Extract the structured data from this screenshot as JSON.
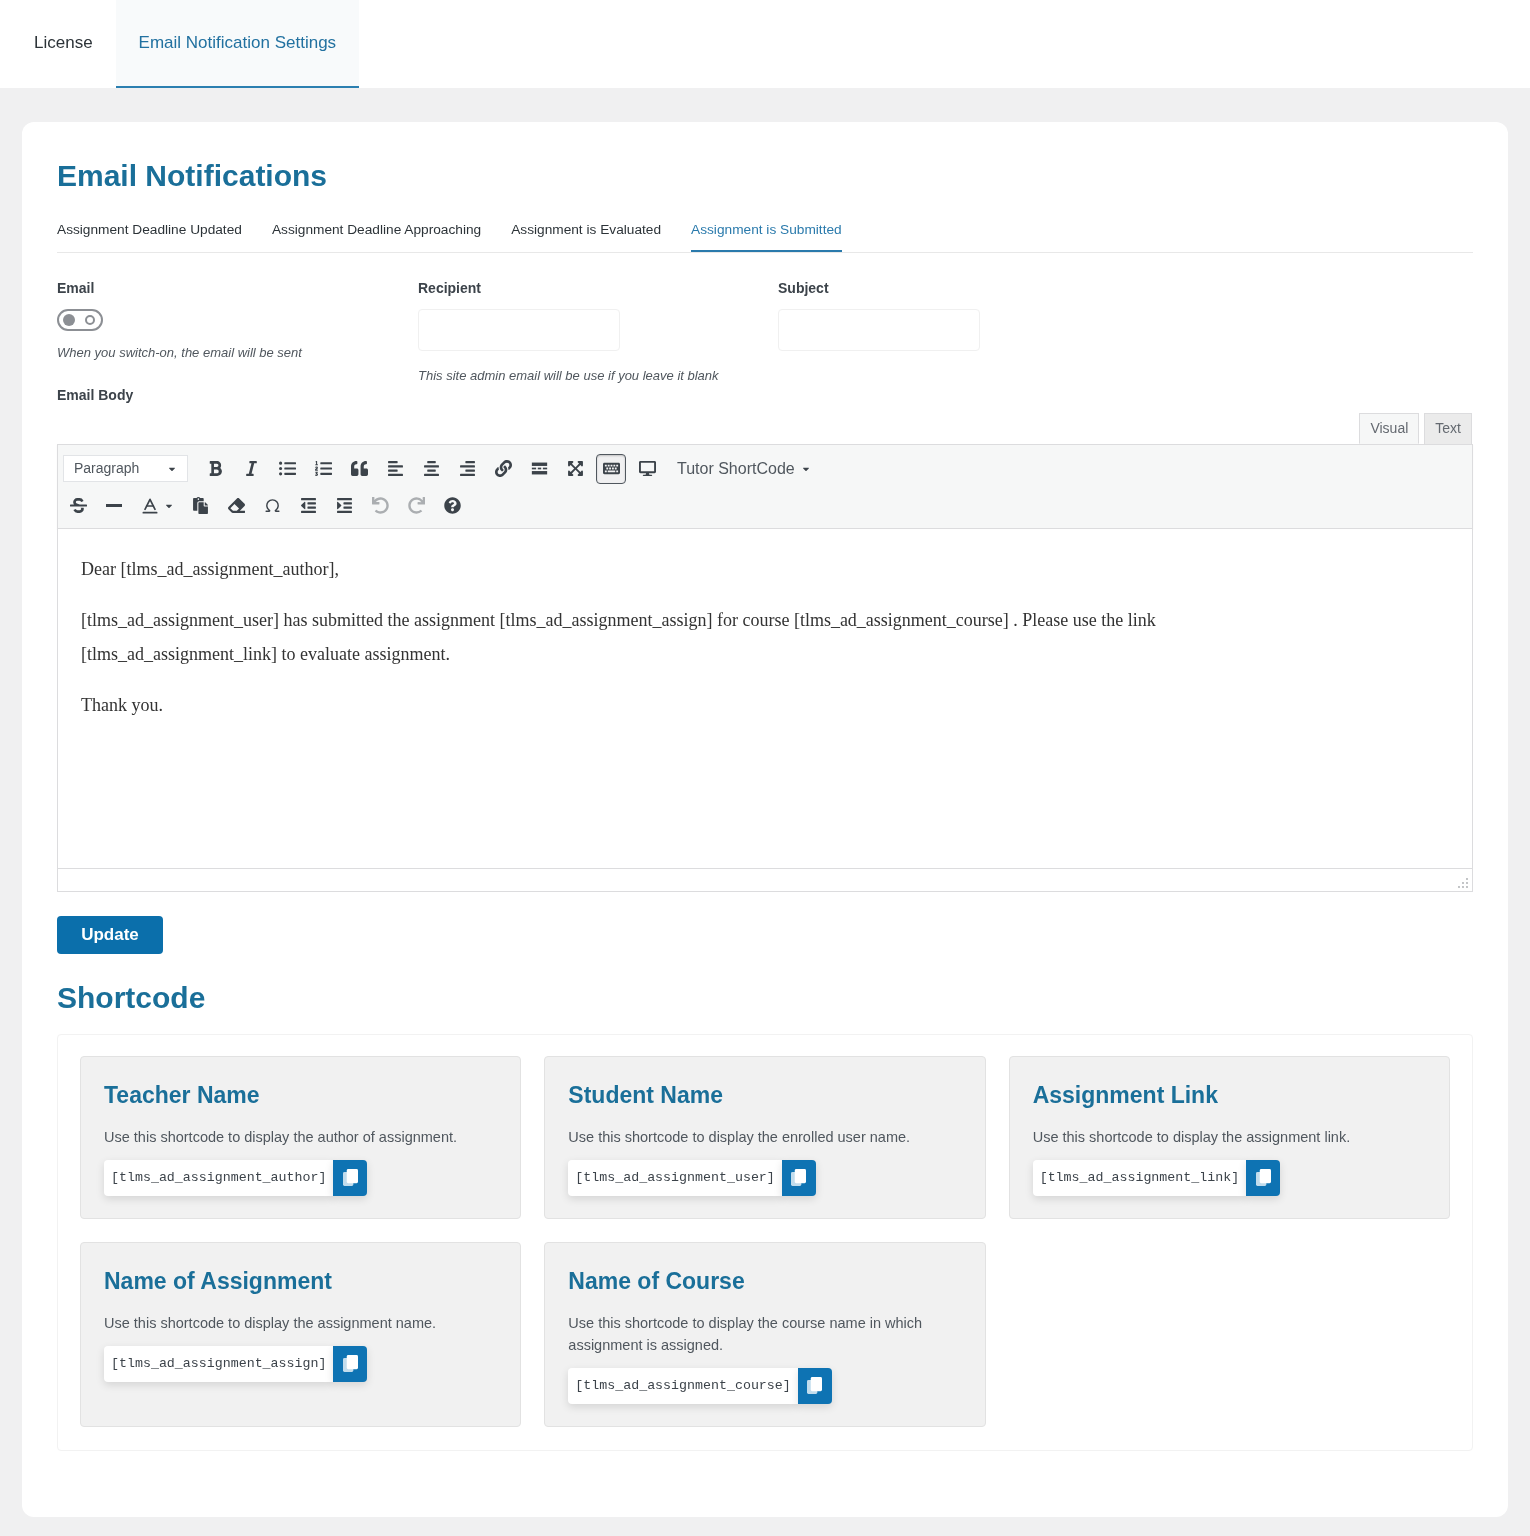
{
  "top_tabs": [
    {
      "label": "License",
      "selected": false
    },
    {
      "label": "Email Notification Settings",
      "selected": true
    }
  ],
  "title": "Email Notifications",
  "notification_tabs": [
    {
      "label": "Assignment Deadline Updated",
      "selected": false
    },
    {
      "label": "Assignment Deadline Approaching",
      "selected": false
    },
    {
      "label": "Assignment is Evaluated",
      "selected": false
    },
    {
      "label": "Assignment is Submitted",
      "selected": true
    }
  ],
  "email": {
    "label": "Email",
    "on": false,
    "hint": "When you switch-on, the email will be sent"
  },
  "recipient": {
    "label": "Recipient",
    "hint": "This site admin email will be use if you leave it blank"
  },
  "subject": {
    "label": "Subject"
  },
  "email_body": {
    "label": "Email Body",
    "editor_tabs": [
      {
        "label": "Visual",
        "selected": true
      },
      {
        "label": "Text",
        "selected": false
      }
    ],
    "toolbar": [
      [
        {
          "kind": "format-select",
          "label": "Paragraph",
          "active": false,
          "disabled": false
        },
        {
          "kind": "bold",
          "active": false,
          "disabled": false
        },
        {
          "kind": "italic",
          "active": false,
          "disabled": false
        },
        {
          "kind": "bullet-list",
          "active": false,
          "disabled": false
        },
        {
          "kind": "numbered-list",
          "active": false,
          "disabled": false
        },
        {
          "kind": "blockquote",
          "active": false,
          "disabled": false
        },
        {
          "kind": "align-left",
          "active": false,
          "disabled": false
        },
        {
          "kind": "align-center",
          "active": false,
          "disabled": false
        },
        {
          "kind": "align-right",
          "active": false,
          "disabled": false
        },
        {
          "kind": "link",
          "active": false,
          "disabled": false
        },
        {
          "kind": "read-more",
          "active": false,
          "disabled": false
        },
        {
          "kind": "fullscreen",
          "active": false,
          "disabled": false
        },
        {
          "kind": "toolbar-toggle",
          "active": true,
          "disabled": false
        },
        {
          "kind": "preview",
          "active": false,
          "disabled": false
        },
        {
          "kind": "menu",
          "label": "Tutor ShortCode",
          "active": false,
          "disabled": false
        }
      ],
      [
        {
          "kind": "strikethrough",
          "active": false,
          "disabled": false
        },
        {
          "kind": "horizontal-line",
          "active": false,
          "disabled": false
        },
        {
          "kind": "text-color",
          "active": false,
          "disabled": false
        },
        {
          "kind": "paste-text",
          "active": false,
          "disabled": false
        },
        {
          "kind": "clear-formatting",
          "active": false,
          "disabled": false
        },
        {
          "kind": "special-character",
          "active": false,
          "disabled": false
        },
        {
          "kind": "outdent",
          "active": false,
          "disabled": false
        },
        {
          "kind": "indent",
          "active": false,
          "disabled": false
        },
        {
          "kind": "undo",
          "active": false,
          "disabled": true
        },
        {
          "kind": "redo",
          "active": false,
          "disabled": true
        },
        {
          "kind": "help",
          "active": false,
          "disabled": false
        }
      ]
    ],
    "paragraphs": [
      "Dear [tlms_ad_assignment_author],",
      "[tlms_ad_assignment_user] has submitted the assignment [tlms_ad_assignment_assign] for course [tlms_ad_assignment_course] . Please use the link [tlms_ad_assignment_link] to evaluate assignment.",
      "Thank you."
    ]
  },
  "update_button": "Update",
  "shortcode": {
    "title": "Shortcode",
    "cards": [
      {
        "title": "Teacher Name",
        "description": "Use this shortcode to display the author of assignment.",
        "code": "[tlms_ad_assignment_author]"
      },
      {
        "title": "Student Name",
        "description": "Use this shortcode to display the enrolled user name.",
        "code": "[tlms_ad_assignment_user]"
      },
      {
        "title": "Assignment Link",
        "description": "Use this shortcode to display the assignment link.",
        "code": "[tlms_ad_assignment_link]"
      },
      {
        "title": "Name of Assignment",
        "description": "Use this shortcode to display the assignment name.",
        "code": "[tlms_ad_assignment_assign]"
      },
      {
        "title": "Name of Course",
        "description": "Use this shortcode to display the course name in which assignment is assigned.",
        "code": "[tlms_ad_assignment_course]"
      }
    ]
  }
}
